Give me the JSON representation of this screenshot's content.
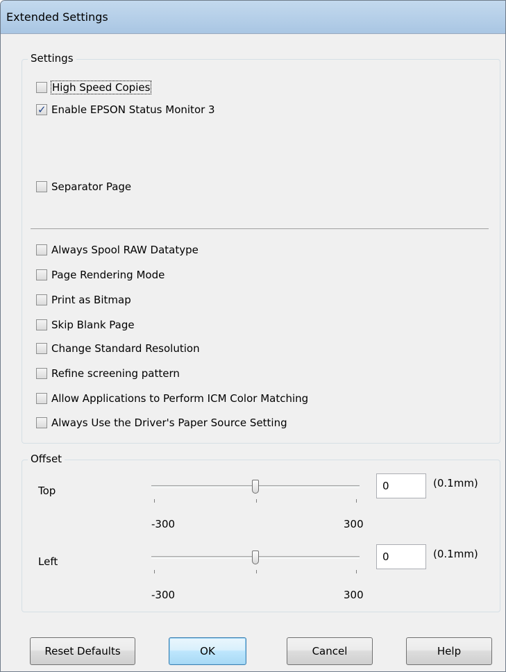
{
  "window": {
    "title": "Extended Settings"
  },
  "settings": {
    "group_label": "Settings",
    "checkboxes": [
      {
        "label": "High Speed Copies",
        "checked": false
      },
      {
        "label": "Enable EPSON Status Monitor 3",
        "checked": true
      },
      {
        "label": "Separator Page",
        "checked": false
      },
      {
        "label": "Always Spool RAW Datatype",
        "checked": false
      },
      {
        "label": "Page Rendering Mode",
        "checked": false
      },
      {
        "label": "Print as Bitmap",
        "checked": false
      },
      {
        "label": "Skip Blank Page",
        "checked": false
      },
      {
        "label": "Change Standard Resolution",
        "checked": false
      },
      {
        "label": "Refine screening pattern",
        "checked": false
      },
      {
        "label": "Allow Applications to Perform ICM Color Matching",
        "checked": false
      },
      {
        "label": "Always Use the Driver's Paper Source Setting",
        "checked": false
      }
    ]
  },
  "offset": {
    "group_label": "Offset",
    "top": {
      "label": "Top",
      "value": "0",
      "unit": "(0.1mm)",
      "min": "-300",
      "max": "300",
      "slider_value": 0
    },
    "left": {
      "label": "Left",
      "value": "0",
      "unit": "(0.1mm)",
      "min": "-300",
      "max": "300",
      "slider_value": 0
    }
  },
  "buttons": {
    "reset": "Reset Defaults",
    "ok": "OK",
    "cancel": "Cancel",
    "help": "Help"
  },
  "colors": {
    "titlebar": "#b9d1ea",
    "check": "#21458a",
    "default_button_border": "#3c7fb1"
  }
}
